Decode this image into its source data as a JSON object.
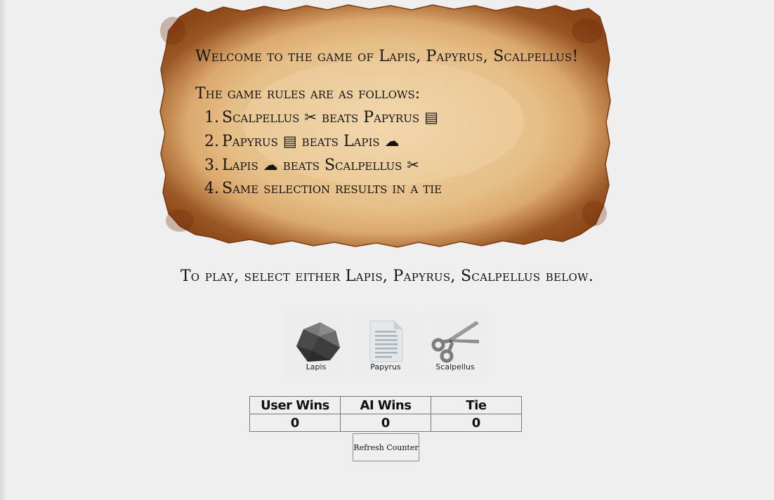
{
  "scroll": {
    "welcome": "Welcome to the game of Lapis, Papyrus, Scalpellus!",
    "rules_heading": "The game rules are as follows:",
    "rules": [
      {
        "num": "1.",
        "before": "Scalpellus ",
        "icon1": "✂",
        "mid": " beats Papyrus ",
        "icon2": "▤"
      },
      {
        "num": "2.",
        "before": "Papyrus ",
        "icon1": "▤",
        "mid": " beats Lapis ",
        "icon2": "☁"
      },
      {
        "num": "3.",
        "before": "Lapis ",
        "icon1": "☁",
        "mid": " beats Scalpellus ",
        "icon2": "✂"
      },
      {
        "num": "4.",
        "before": "Same selection results in a tie",
        "icon1": "",
        "mid": "",
        "icon2": ""
      }
    ]
  },
  "instruction": "To play, select either Lapis, Papyrus, Scalpellus below.",
  "choices": [
    {
      "label": "Lapis",
      "icon": "rock-icon"
    },
    {
      "label": "Papyrus",
      "icon": "paper-document-icon"
    },
    {
      "label": "Scalpellus",
      "icon": "scissors-icon"
    }
  ],
  "scoreboard": {
    "headers": [
      "User Wins",
      "AI Wins",
      "Tie"
    ],
    "values": [
      "0",
      "0",
      "0"
    ]
  },
  "refresh_label": "Refresh Counter",
  "colors": {
    "background": "#efefef",
    "parchment": "#e2b885",
    "parchment_edge": "#8a4a1a"
  }
}
